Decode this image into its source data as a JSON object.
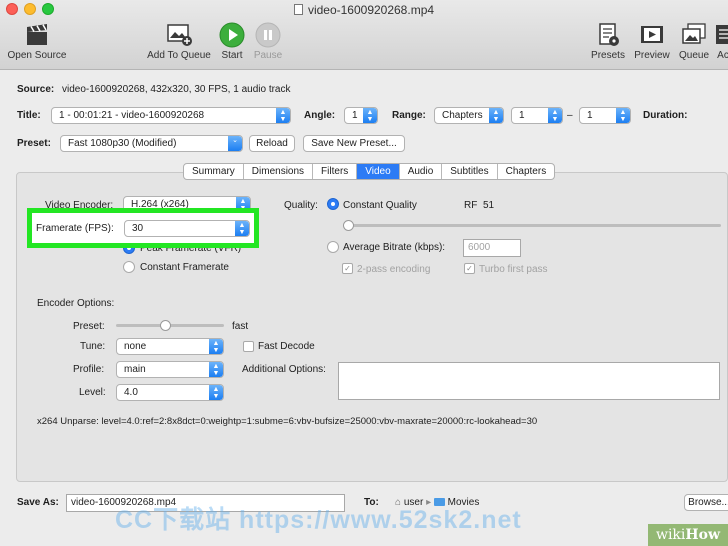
{
  "window": {
    "title": "video-1600920268.mp4"
  },
  "toolbar": {
    "open_source": "Open Source",
    "add_to_queue": "Add To Queue",
    "start": "Start",
    "pause": "Pause",
    "presets": "Presets",
    "preview": "Preview",
    "queue": "Queue",
    "activity": "Ac"
  },
  "source": {
    "label": "Source:",
    "value": "video-1600920268, 432x320, 30 FPS, 1 audio track"
  },
  "title_row": {
    "title_label": "Title:",
    "title_value": "1 - 00:01:21 - video-1600920268",
    "angle_label": "Angle:",
    "angle_value": "1",
    "range_label": "Range:",
    "range_value": "Chapters",
    "range_start": "1",
    "range_dash": "–",
    "range_end": "1",
    "duration_label": "Duration:"
  },
  "preset_row": {
    "label": "Preset:",
    "value": "Fast 1080p30 (Modified)",
    "reload": "Reload",
    "save_new": "Save New Preset..."
  },
  "tabs": [
    "Summary",
    "Dimensions",
    "Filters",
    "Video",
    "Audio",
    "Subtitles",
    "Chapters"
  ],
  "active_tab": "Video",
  "video": {
    "encoder_label": "Video Encoder:",
    "encoder_value": "H.264 (x264)",
    "framerate_label": "Framerate (FPS):",
    "framerate_value": "30",
    "peak_label": "Peak Framerate (VFR)",
    "constant_label": "Constant Framerate",
    "quality_label": "Quality:",
    "cq_label": "Constant Quality",
    "rf_label": "RF",
    "rf_value": "51",
    "abr_label": "Average Bitrate (kbps):",
    "abr_value": "6000",
    "two_pass": "2-pass encoding",
    "turbo": "Turbo first pass",
    "constant_quality_fraction": 0.0
  },
  "encoder_options": {
    "title": "Encoder Options:",
    "preset_label": "Preset:",
    "preset_value": "fast",
    "preset_fraction": 0.45,
    "tune_label": "Tune:",
    "tune_value": "none",
    "fast_decode": "Fast Decode",
    "profile_label": "Profile:",
    "profile_value": "main",
    "additional_label": "Additional Options:",
    "level_label": "Level:",
    "level_value": "4.0",
    "unparse": "x264 Unparse: level=4.0:ref=2:8x8dct=0:weightp=1:subme=6:vbv-bufsize=25000:vbv-maxrate=20000:rc-lookahead=30"
  },
  "footer": {
    "save_as_label": "Save As:",
    "save_as_value": "video-1600920268.mp4",
    "to_label": "To:",
    "path_user": "user",
    "path_sep": "▸",
    "path_folder": "Movies",
    "browse": "Browse..."
  },
  "watermark": {
    "text": "CC下载站 https://www.52sk2.net",
    "wikihow_a": "wiki",
    "wikihow_b": "How"
  },
  "colors": {
    "accent": "#2c7bf5",
    "highlight": "#23e623",
    "start_green": "#3cae3c"
  }
}
